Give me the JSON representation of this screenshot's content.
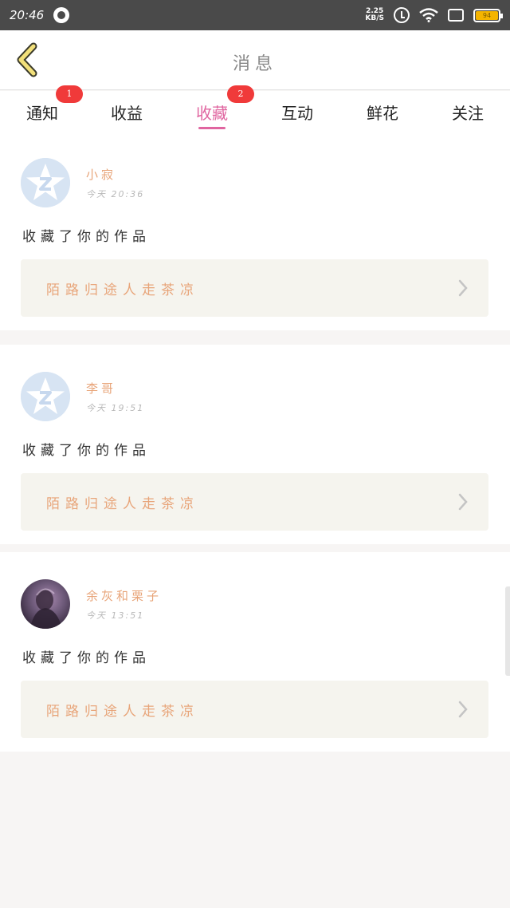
{
  "status_bar": {
    "time": "20:46",
    "net_speed_value": "2.25",
    "net_speed_unit": "KB/S",
    "battery_level": "94",
    "battery_color": "#f5b400"
  },
  "header": {
    "title": "消息",
    "back_icon": "chevron-left-icon"
  },
  "tabs": [
    {
      "label": "通知",
      "badge": "1",
      "active": false
    },
    {
      "label": "收益",
      "badge": "",
      "active": false
    },
    {
      "label": "收藏",
      "badge": "2",
      "active": true
    },
    {
      "label": "互动",
      "badge": "",
      "active": false
    },
    {
      "label": "鲜花",
      "badge": "",
      "active": false
    },
    {
      "label": "关注",
      "badge": "",
      "active": false
    }
  ],
  "accent_color": "#e065a0",
  "messages": [
    {
      "user": "小寂",
      "time": "今天 20:36",
      "action": "收藏了你的作品",
      "work_title": "陌路归途人走茶凉",
      "avatar": "default-qq-avatar"
    },
    {
      "user": "李哥",
      "time": "今天 19:51",
      "action": "收藏了你的作品",
      "work_title": "陌路归途人走茶凉",
      "avatar": "default-qq-avatar"
    },
    {
      "user": "余灰和栗子",
      "time": "今天 13:51",
      "action": "收藏了你的作品",
      "work_title": "陌路归途人走茶凉",
      "avatar": "photo-avatar"
    }
  ]
}
